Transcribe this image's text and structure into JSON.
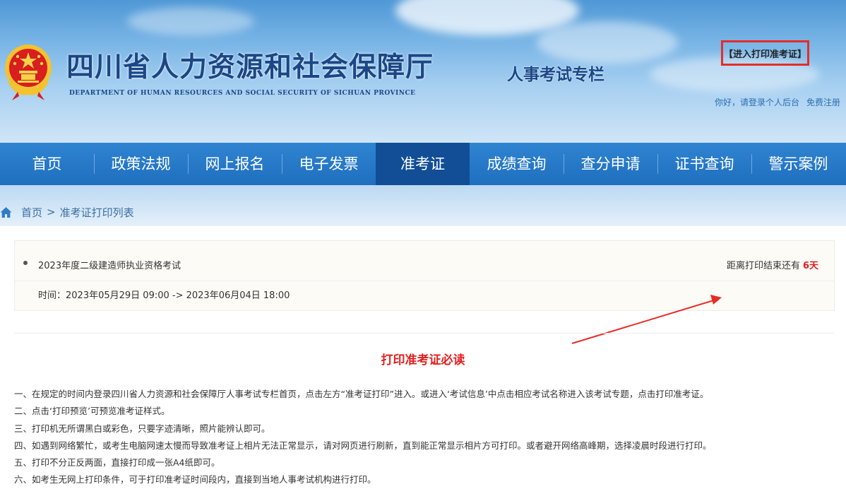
{
  "header": {
    "title_cn": "四川省人力资源和社会保障厅",
    "title_en": "DEPARTMENT OF HUMAN RESOURCES AND SOCIAL SECURITY OF SICHUAN PROVINCE",
    "column": "人事考试专栏",
    "login_link": "你好，请登录个人后台",
    "register_link": "免费注册",
    "emblem_icon": "national-emblem-icon"
  },
  "nav": {
    "items": [
      {
        "label": "首页"
      },
      {
        "label": "政策法规"
      },
      {
        "label": "网上报名"
      },
      {
        "label": "电子发票"
      },
      {
        "label": "准考证"
      },
      {
        "label": "成绩查询"
      },
      {
        "label": "查分申请"
      },
      {
        "label": "证书查询"
      },
      {
        "label": "警示案例"
      }
    ],
    "active": "准考证"
  },
  "breadcrumb": {
    "icon": "home-icon",
    "home": "首页",
    "separator": ">",
    "current": "准考证打印列表"
  },
  "exam": {
    "name": "2023年度二级建造师执业资格考试",
    "countdown_label": "距离打印结束还有",
    "countdown_value": "6天",
    "time_text": "时间：2023年05月29日 09:00 -> 2023年06月04日 18:00",
    "button": "【进入打印准考证】"
  },
  "notice": {
    "title": "打印准考证必读",
    "items": [
      "一、在规定的时间内登录四川省人力资源和社会保障厅人事考试专栏首页，点击左方“准考证打印”进入。或进入‘考试信息’中点击相应考试名称进入该考试专题，点击打印准考证。",
      "二、点击‘打印预览’可预览准考证样式。",
      "三、打印机无所谓黑白或彩色，只要字迹清晰，照片能辨认即可。",
      "四、如遇到网络繁忙，或考生电脑网速太慢而导致准考证上相片无法正常显示，请对网页进行刷新，直到能正常显示相片方可打印。或者避开网络高峰期，选择凌晨时段进行打印。",
      "五、打印不分正反两面，直接打印成一张A4纸即可。",
      "六、如考生无网上打印条件，可于打印准考证时间段内，直接到当地人事考试机构进行打印。"
    ]
  },
  "colors": {
    "nav_bg": "#1f6fbf",
    "nav_active": "#114e95",
    "title_blue": "#1a4787",
    "accent_red": "#e02020"
  }
}
